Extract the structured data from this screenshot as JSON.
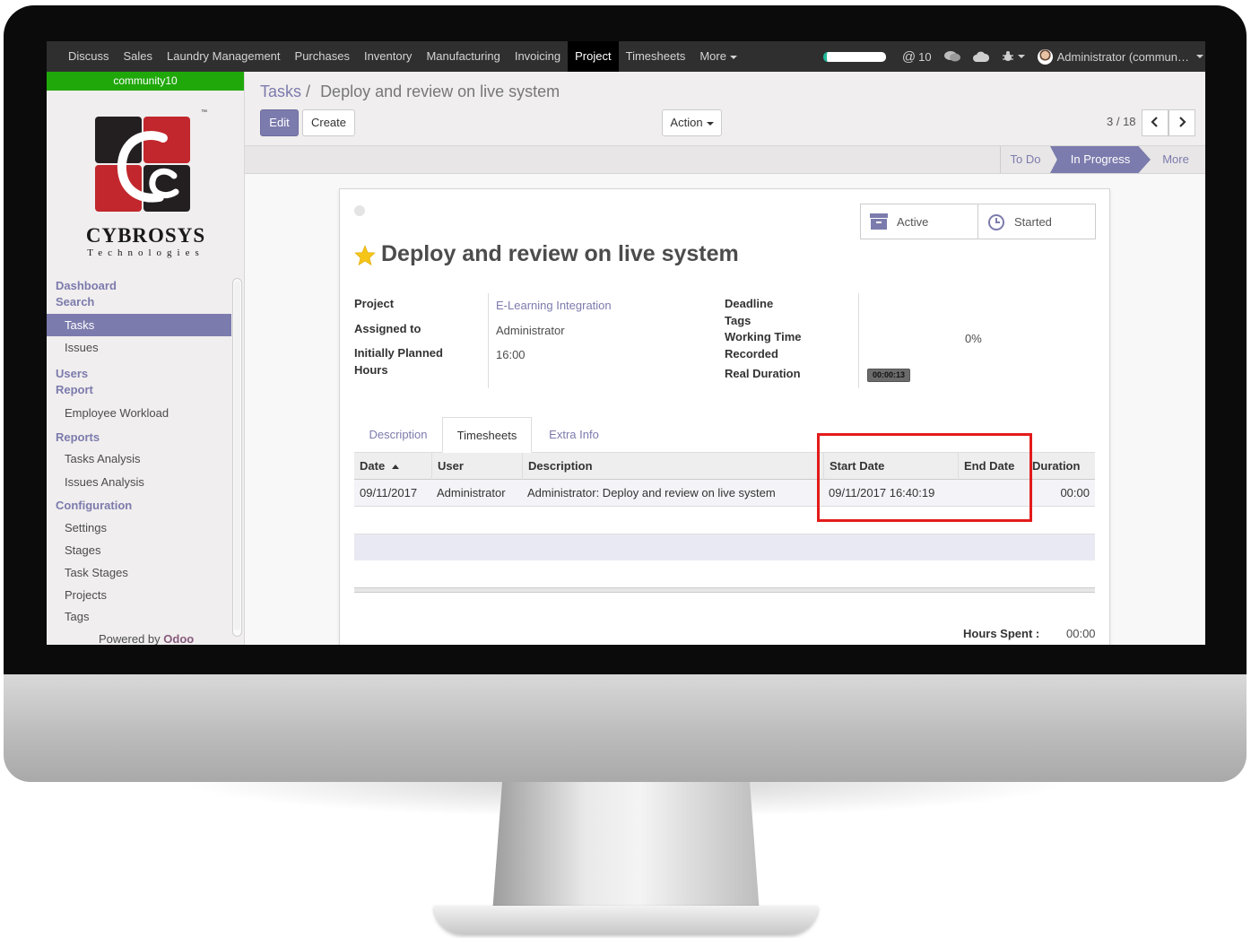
{
  "nav": {
    "items": [
      "Discuss",
      "Sales",
      "Laundry Management",
      "Purchases",
      "Inventory",
      "Manufacturing",
      "Invoicing",
      "Project",
      "Timesheets",
      "More"
    ],
    "active": "Project",
    "mentions": "10",
    "user": "Administrator (commun…"
  },
  "sidebar": {
    "db_name": "community10",
    "brand": "CYBROSYS",
    "brand_sub": "Technologies",
    "tm": "™",
    "sections": [
      {
        "header": "Dashboard",
        "items": []
      },
      {
        "header": "Search",
        "items": [
          "Tasks",
          "Issues"
        ]
      },
      {
        "header": "Users",
        "items": []
      },
      {
        "header": "Report",
        "items": [
          "Employee Workload"
        ]
      },
      {
        "header": "Reports",
        "items": [
          "Tasks Analysis",
          "Issues Analysis"
        ]
      },
      {
        "header": "Configuration",
        "items": [
          "Settings",
          "Stages",
          "Task Stages",
          "Projects",
          "Tags"
        ]
      }
    ],
    "selected": "Tasks",
    "powered_by": "Powered by",
    "powered_brand": "Odoo"
  },
  "breadcrumb": {
    "parent": "Tasks",
    "separator": "/",
    "current": "Deploy and review on live system"
  },
  "buttons": {
    "edit": "Edit",
    "create": "Create",
    "action": "Action"
  },
  "pager": {
    "value": "3 / 18"
  },
  "stages": {
    "todo": "To Do",
    "current": "In Progress",
    "more": "More"
  },
  "stat_buttons": {
    "active": "Active",
    "started": "Started"
  },
  "task": {
    "title": "Deploy and review on live system",
    "fields": {
      "project_label": "Project",
      "project_value": "E-Learning Integration",
      "assigned_label": "Assigned to",
      "assigned_value": "Administrator",
      "planned_label_1": "Initially Planned",
      "planned_label_2": "Hours",
      "planned_value": "16:00",
      "deadline_label": "Deadline",
      "tags_label": "Tags",
      "working_label_1": "Working Time",
      "working_label_2": "Recorded",
      "working_value": "0%",
      "duration_label": "Real Duration",
      "duration_value": "00:00:13"
    }
  },
  "tabs": [
    "Description",
    "Timesheets",
    "Extra Info"
  ],
  "active_tab": "Timesheets",
  "table": {
    "columns": [
      "Date",
      "User",
      "Description",
      "Start Date",
      "End Date",
      "Duration"
    ],
    "rows": [
      [
        "09/11/2017",
        "Administrator",
        "Administrator: Deploy and review on live system",
        "09/11/2017 16:40:19",
        "",
        "00:00"
      ]
    ]
  },
  "footer": {
    "hours_spent_label": "Hours Spent :",
    "hours_spent_value": "00:00"
  },
  "colors": {
    "accent": "#7c7bad",
    "db_green": "#20a80b",
    "highlight": "#e31b1b"
  }
}
